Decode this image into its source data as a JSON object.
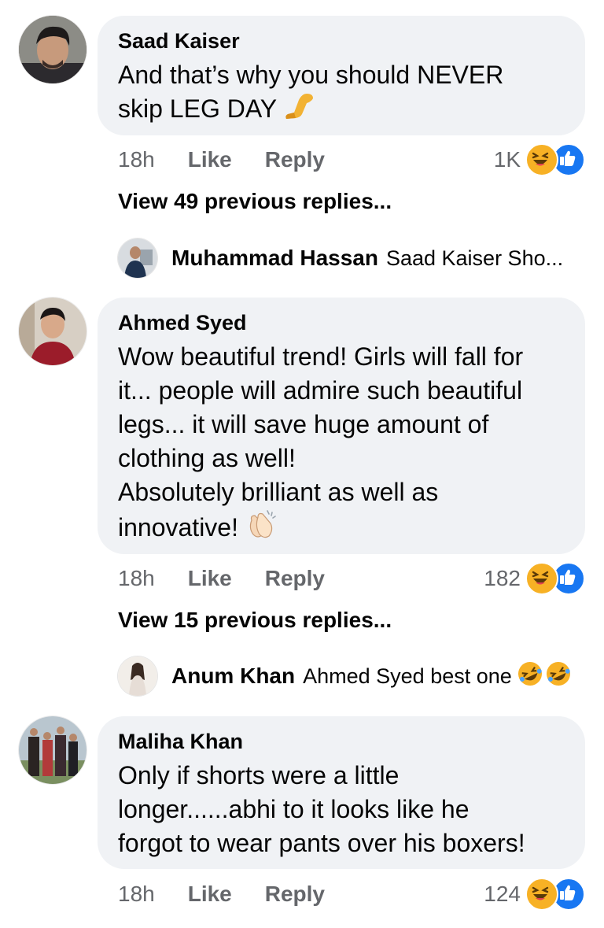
{
  "comments": [
    {
      "author": "Saad Kaiser",
      "lines": [
        "And that’s why you should NEVER",
        "skip LEG DAY"
      ],
      "time": "18h",
      "like_label": "Like",
      "reply_label": "Reply",
      "reaction_count": "1K",
      "view_replies": "View 49 previous replies...",
      "latest_reply": {
        "name": "Muhammad Hassan",
        "text": "Saad Kaiser Sho..."
      }
    },
    {
      "author": "Ahmed Syed",
      "lines": [
        "Wow beautiful trend! Girls will fall for",
        "it... people will admire such beautiful",
        "legs... it will save huge amount of",
        "clothing as well!",
        "Absolutely brilliant as well as",
        "innovative!"
      ],
      "time": "18h",
      "like_label": "Like",
      "reply_label": "Reply",
      "reaction_count": "182",
      "view_replies": "View 15 previous replies...",
      "latest_reply": {
        "name": "Anum Khan",
        "text": "Ahmed Syed best one"
      }
    },
    {
      "author": "Maliha Khan",
      "lines": [
        "Only if shorts were a little",
        "longer......abhi to it looks like he",
        "forgot to wear pants over his boxers!"
      ],
      "time": "18h",
      "like_label": "Like",
      "reply_label": "Reply",
      "reaction_count": "124"
    }
  ],
  "icons": {
    "reactions": [
      "haha-icon",
      "like-icon"
    ],
    "emojis": [
      "leg-emoji",
      "clapping-hands-emoji",
      "rolling-laughing-emoji"
    ]
  },
  "colors": {
    "bubble": "#f0f2f5",
    "secondary_text": "#65676b",
    "like_blue": "#1877f2",
    "haha_yellow": "#f7b125"
  }
}
